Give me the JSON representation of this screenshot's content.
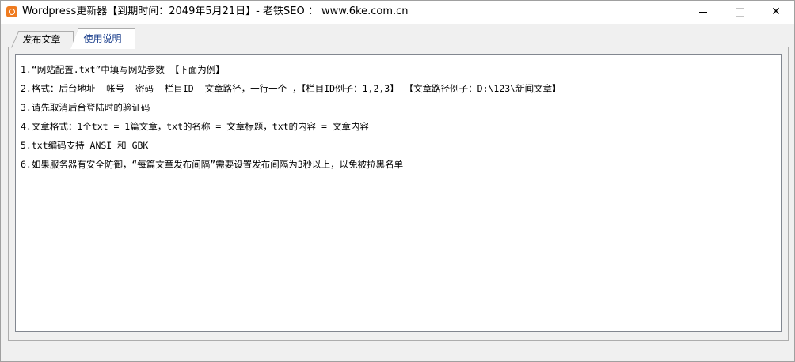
{
  "window": {
    "title": "Wordpress更新器【到期时间：2049年5月21日】- 老铁SEO ： www.6ke.com.cn",
    "buttons": {
      "minimize": "",
      "maximize": "",
      "close": "✕"
    }
  },
  "tabs": [
    {
      "label": "发布文章"
    },
    {
      "label": "使用说明"
    }
  ],
  "content": {
    "lines": [
      "1.“网站配置.txt”中填写网站参数 【下面为例】",
      "2.格式：后台地址——帐号——密码——栏目ID——文章路径，一行一个 ，【栏目ID例子：1,2,3】 【文章路径例子：D:\\123\\新闻文章】",
      "3.请先取消后台登陆时的验证码",
      "4.文章格式：1个txt = 1篇文章，txt的名称 = 文章标题，txt的内容 = 文章内容",
      "5.txt编码支持 ANSI 和 GBK",
      "6.如果服务器有安全防御，“每篇文章发布间隔”需要设置发布间隔为3秒以上，以免被拉黑名单"
    ]
  },
  "colors": {
    "icon": "#ef7b1f",
    "active_tab_text": "#1a3e8c"
  }
}
